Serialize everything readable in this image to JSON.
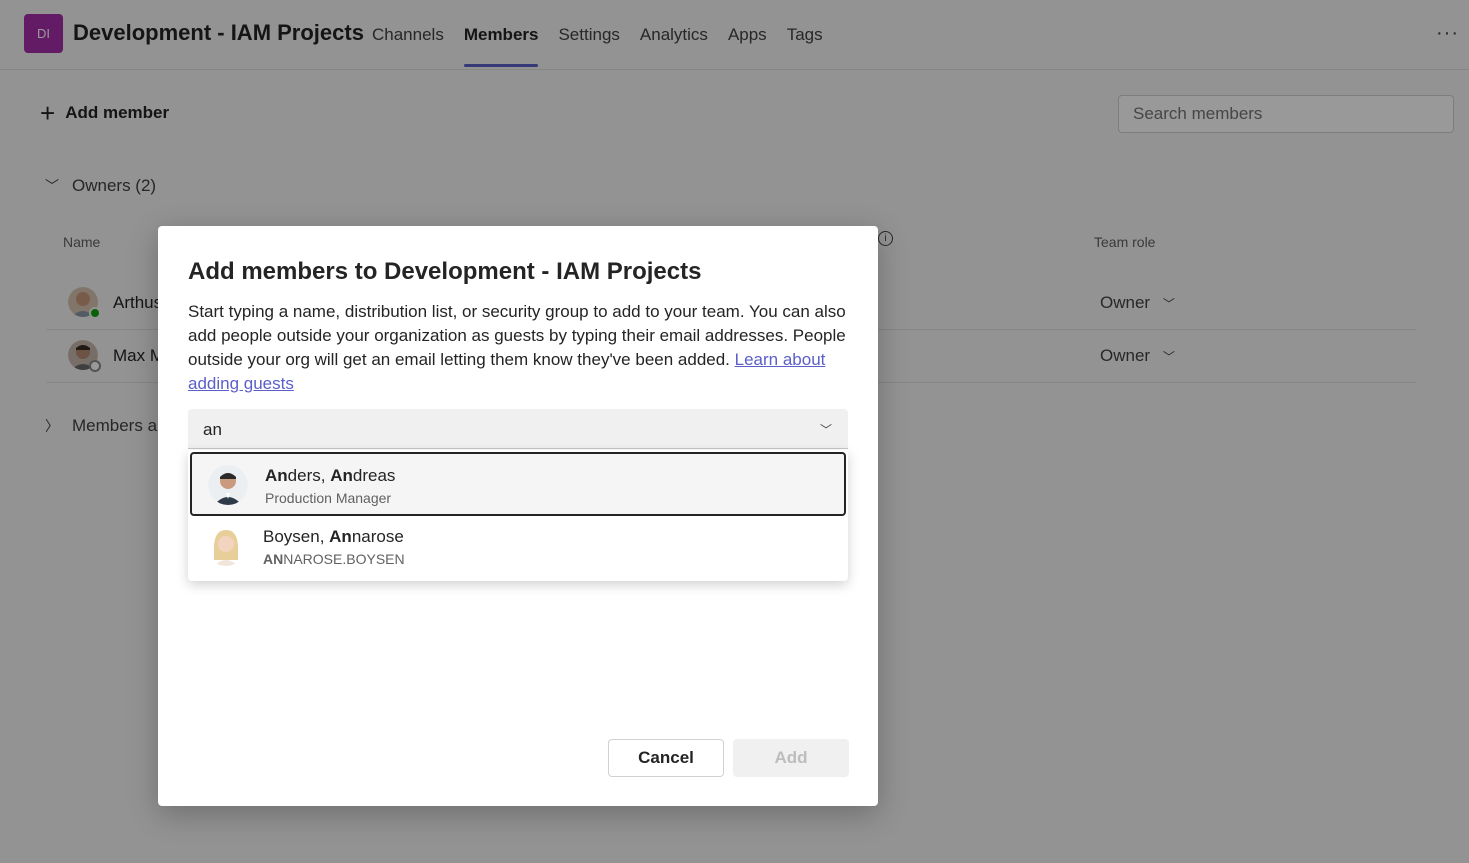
{
  "header": {
    "team_initials": "DI",
    "team_title": "Development - IAM Projects",
    "tabs": [
      "Channels",
      "Members",
      "Settings",
      "Analytics",
      "Apps",
      "Tags"
    ],
    "active_tab": "Members",
    "more_label": "···"
  },
  "toolbar": {
    "add_member_label": "Add member",
    "search_placeholder": "Search members"
  },
  "owners_section": {
    "label": "Owners (2)",
    "col_name": "Name",
    "col_role": "Team role",
    "rows": [
      {
        "name": "Arthus",
        "role": "Owner",
        "status": "available"
      },
      {
        "name": "Max M",
        "role": "Owner",
        "status": "offline"
      }
    ]
  },
  "members_section": {
    "label": "Members an"
  },
  "dialog": {
    "title": "Add members to Development - IAM Projects",
    "description": "Start typing a name, distribution list, or security group to add to your team. You can also add people outside your organization as guests by typing their email addresses. People outside your org will get an email letting them know they've been added.",
    "link_text": "Learn about adding guests",
    "input_value": "an",
    "suggestions": [
      {
        "match": "An",
        "name_rest": "ders, ",
        "match2": "An",
        "name_rest2": "dreas",
        "sub_match": "",
        "sub_rest": "Production Manager"
      },
      {
        "match": "",
        "name_rest": "Boysen, ",
        "match2": "An",
        "name_rest2": "narose",
        "sub_match": "AN",
        "sub_rest": "NAROSE.BOYSEN"
      }
    ],
    "cancel_label": "Cancel",
    "add_label": "Add"
  },
  "colors": {
    "accent": "#5b5fc7",
    "team_avatar": "#a52da8",
    "available": "#13a10e"
  }
}
